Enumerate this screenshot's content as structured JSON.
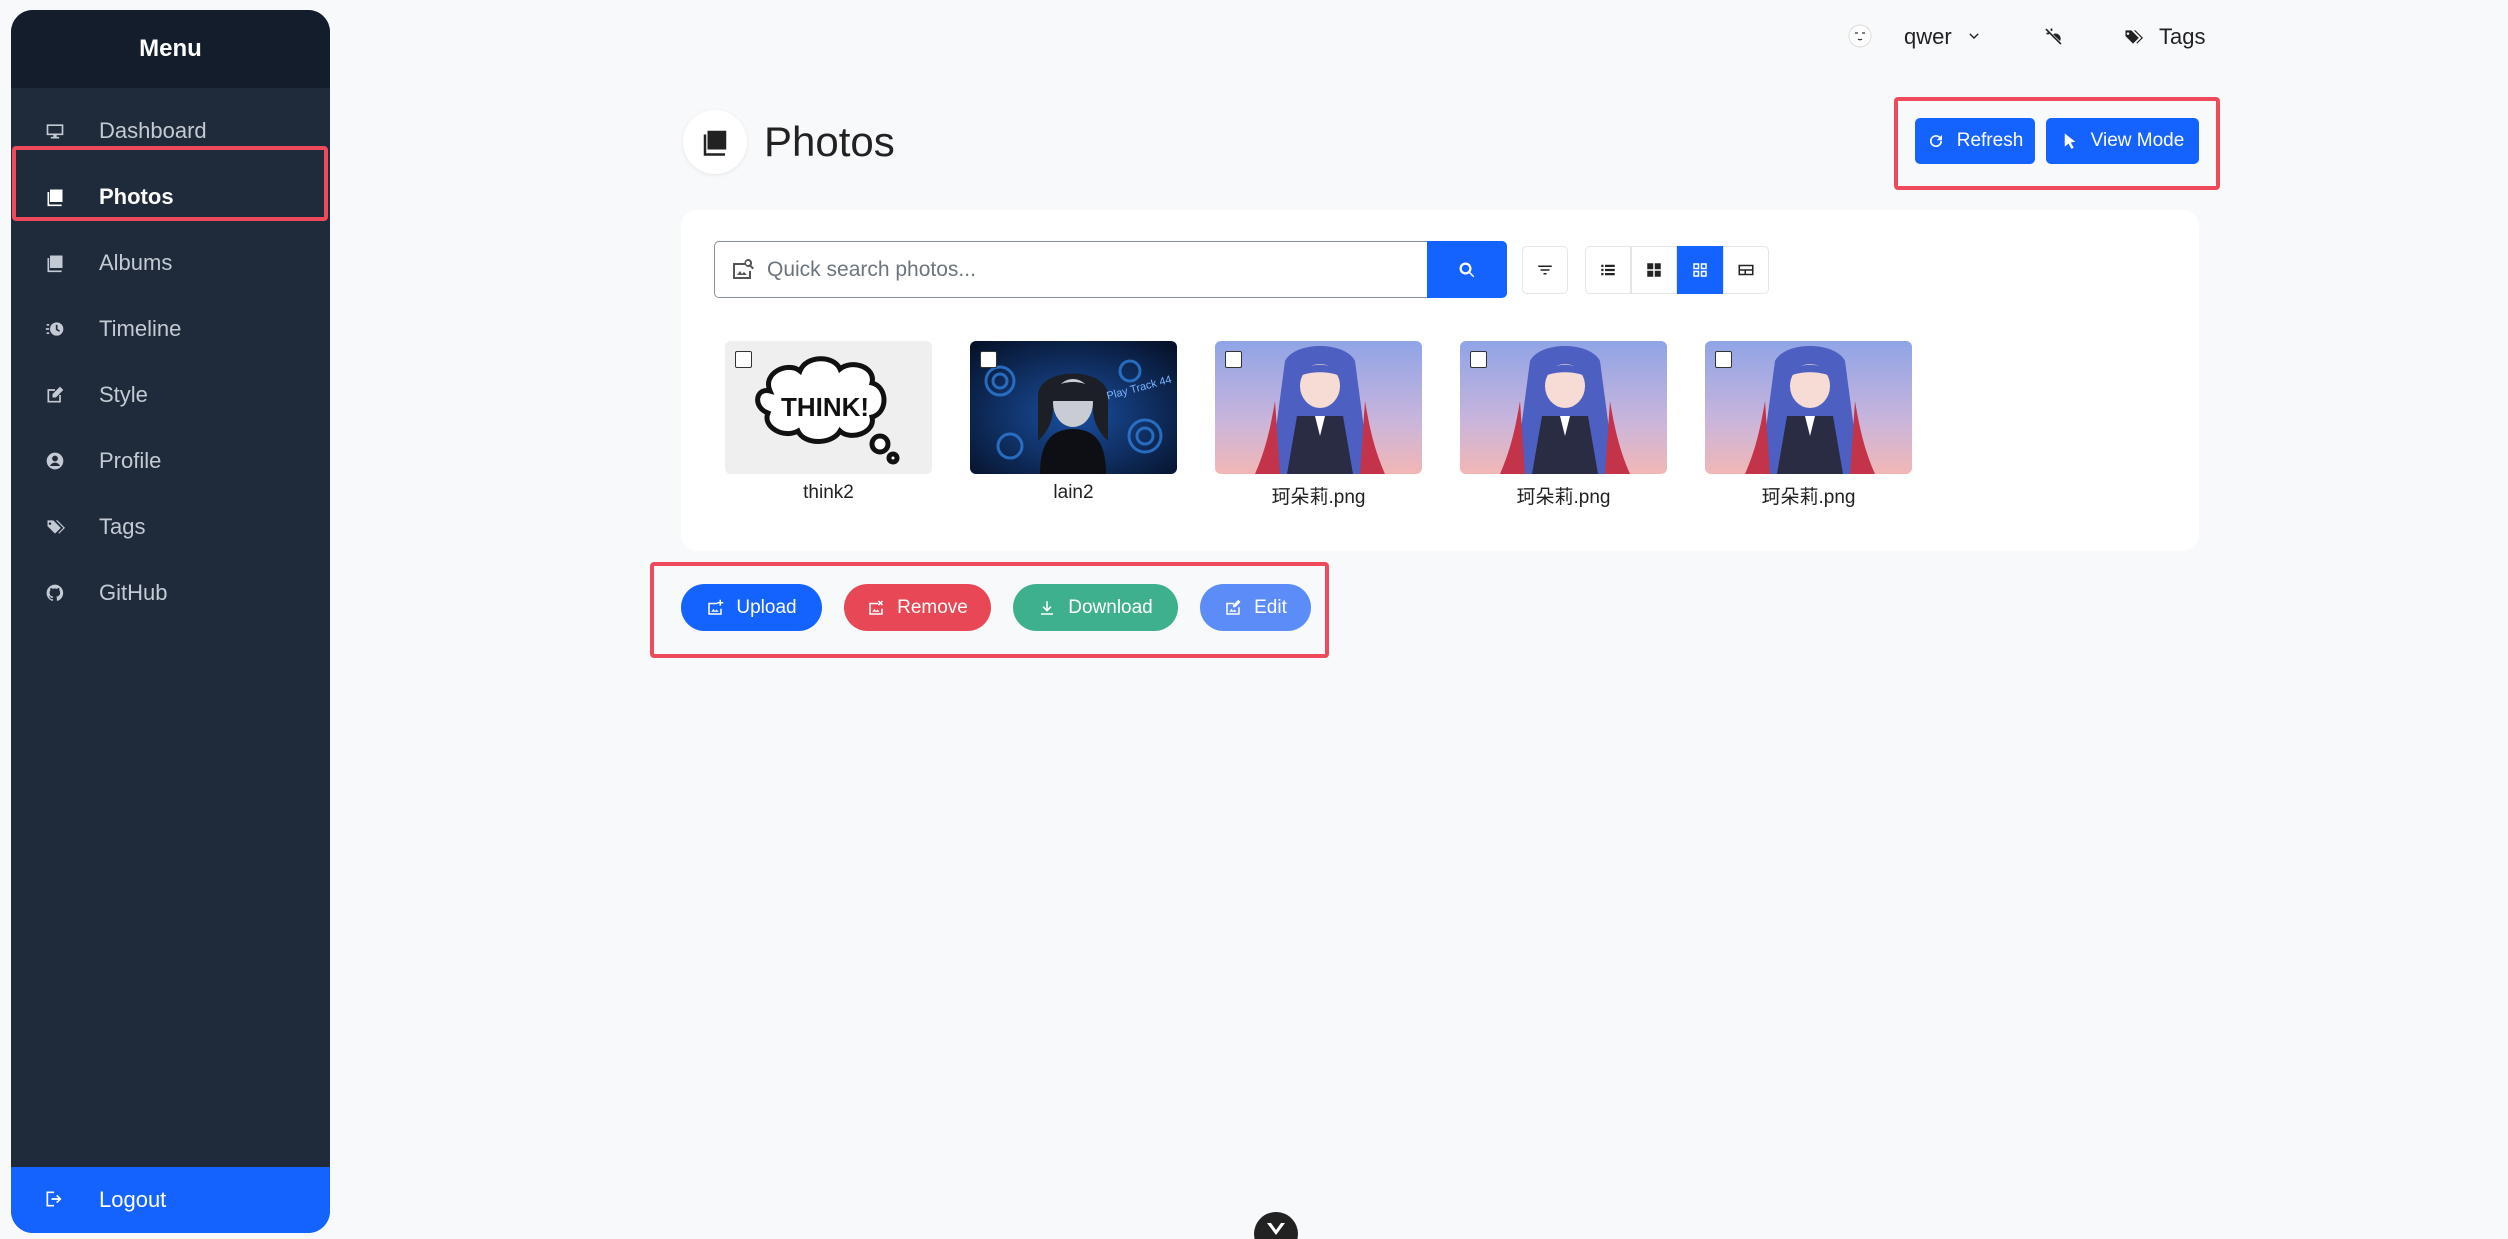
{
  "sidebar": {
    "title": "Menu",
    "items": [
      {
        "label": "Dashboard",
        "icon": "monitor-icon"
      },
      {
        "label": "Photos",
        "icon": "images-icon",
        "active": true
      },
      {
        "label": "Albums",
        "icon": "albums-icon"
      },
      {
        "label": "Timeline",
        "icon": "timeline-icon"
      },
      {
        "label": "Style",
        "icon": "edit-icon"
      },
      {
        "label": "Profile",
        "icon": "user-circle-icon"
      },
      {
        "label": "Tags",
        "icon": "tags-icon"
      },
      {
        "label": "GitHub",
        "icon": "github-icon"
      }
    ],
    "logout": "Logout"
  },
  "topbar": {
    "user": "qwer",
    "tags": "Tags"
  },
  "page": {
    "title": "Photos",
    "refresh": "Refresh",
    "view_mode": "View Mode"
  },
  "search": {
    "placeholder": "Quick search photos..."
  },
  "photos": [
    {
      "caption": "think2",
      "thumb_text": "THINK!"
    },
    {
      "caption": "lain2",
      "thumb_text": "Play Track 44"
    },
    {
      "caption": "珂朵莉.png"
    },
    {
      "caption": "珂朵莉.png"
    },
    {
      "caption": "珂朵莉.png"
    }
  ],
  "actions": {
    "upload": "Upload",
    "remove": "Remove",
    "download": "Download",
    "edit": "Edit"
  },
  "colors": {
    "primary": "#1463ff",
    "danger": "#e84855",
    "success": "#3fb08e",
    "edit": "#5b8cf7",
    "sidebar": "#1f2a3a",
    "highlight": "#ee4a5c"
  }
}
